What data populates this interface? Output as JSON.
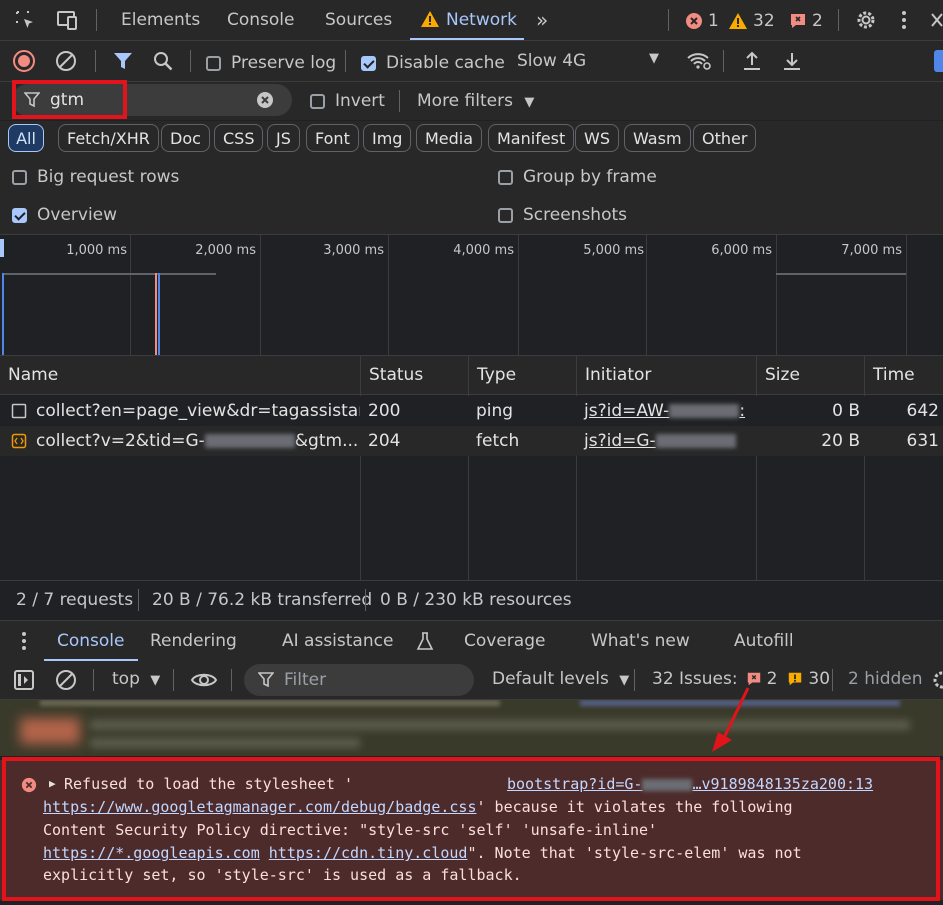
{
  "topbar": {
    "tabs": [
      "Elements",
      "Console",
      "Sources",
      "Network"
    ],
    "active_tab": "Network",
    "more_tabs": "»",
    "error_count": "1",
    "warning_count": "32",
    "issue_count": "2"
  },
  "toolbar": {
    "preserve_log": "Preserve log",
    "disable_cache": "Disable cache",
    "throttling": "Slow 4G"
  },
  "filter": {
    "value": "gtm",
    "invert": "Invert",
    "more_filters": "More filters"
  },
  "type_filters": [
    "All",
    "Fetch/XHR",
    "Doc",
    "CSS",
    "JS",
    "Font",
    "Img",
    "Media",
    "Manifest",
    "WS",
    "Wasm",
    "Other"
  ],
  "options": {
    "big_request_rows": "Big request rows",
    "group_by_frame": "Group by frame",
    "overview": "Overview",
    "screenshots": "Screenshots"
  },
  "overview_ticks": [
    "1,000 ms",
    "2,000 ms",
    "3,000 ms",
    "4,000 ms",
    "5,000 ms",
    "6,000 ms",
    "7,000 ms"
  ],
  "table": {
    "headers": [
      "Name",
      "Status",
      "Type",
      "Initiator",
      "Size",
      "Time"
    ],
    "rows": [
      {
        "name": "collect?en=page_view&dr=tagassistan...",
        "status": "200",
        "type": "ping",
        "initiator": "js?id=AW-",
        "size": "0 B",
        "time": "642"
      },
      {
        "name_a": "collect?v=2&tid=G-",
        "name_b": "&gtm...",
        "status": "204",
        "type": "fetch",
        "initiator": "js?id=G-",
        "size": "20 B",
        "time": "631"
      }
    ]
  },
  "summary": {
    "requests": "2 / 7 requests",
    "transferred": "20 B / 76.2 kB transferred",
    "resources": "0 B / 230 kB resources"
  },
  "drawer": {
    "tabs": [
      "Console",
      "Rendering",
      "AI assistance",
      "Coverage",
      "What's new",
      "Autofill"
    ],
    "active_tab": "Console"
  },
  "console_toolbar": {
    "context": "top",
    "filter_placeholder": "Filter",
    "levels": "Default levels",
    "issues_label": "32 Issues:",
    "issues_errors": "2",
    "issues_warnings": "30",
    "hidden": "2 hidden"
  },
  "console_message": {
    "line1": "Refused to load the stylesheet '",
    "source_link_a": "bootstrap?id=G-",
    "source_link_b": "…v9189848135za200:13",
    "url1": "https://www.googletagmanager.com/debug/badge.css",
    "line2_rest": "' because it violates the following",
    "line3": "Content Security Policy directive: \"style-src 'self' 'unsafe-inline'",
    "url2": "https://*.googleapis.com",
    "url3": "https://cdn.tiny.cloud",
    "line4_rest": "\". Note that 'style-src-elem' was not",
    "line5": "explicitly set, so 'style-src' is used as a fallback."
  },
  "colors": {
    "accent": "#a8c7fa",
    "highlight_box": "#e0141a",
    "error_bg": "#4e2b2b",
    "error_icon": "#f28b82",
    "warning_icon": "#fdd663"
  }
}
